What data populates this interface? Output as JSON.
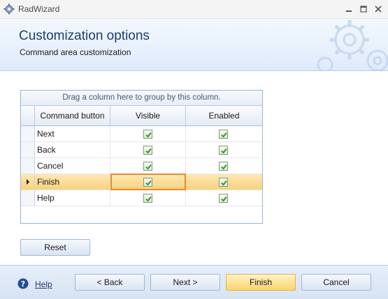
{
  "window": {
    "title": "RadWizard"
  },
  "header": {
    "title": "Customization options",
    "subtitle": "Command area customization"
  },
  "grid": {
    "group_panel_text": "Drag a column here to group by this column.",
    "columns": [
      "Command button",
      "Visible",
      "Enabled"
    ],
    "rows": [
      {
        "name": "Next",
        "visible": true,
        "enabled": true
      },
      {
        "name": "Back",
        "visible": true,
        "enabled": true
      },
      {
        "name": "Cancel",
        "visible": true,
        "enabled": true
      },
      {
        "name": "Finish",
        "visible": true,
        "enabled": true,
        "selected": true
      },
      {
        "name": "Help",
        "visible": true,
        "enabled": true
      }
    ]
  },
  "buttons": {
    "reset": "Reset",
    "back": "<  Back",
    "next": "Next  >",
    "finish": "Finish",
    "cancel": "Cancel"
  },
  "footer": {
    "help_label": "Help"
  },
  "colors": {
    "accent": "#1f3d6b",
    "selection": "#f9d27d",
    "focus_border": "#e98a2b",
    "check": "#2f8f2f"
  }
}
